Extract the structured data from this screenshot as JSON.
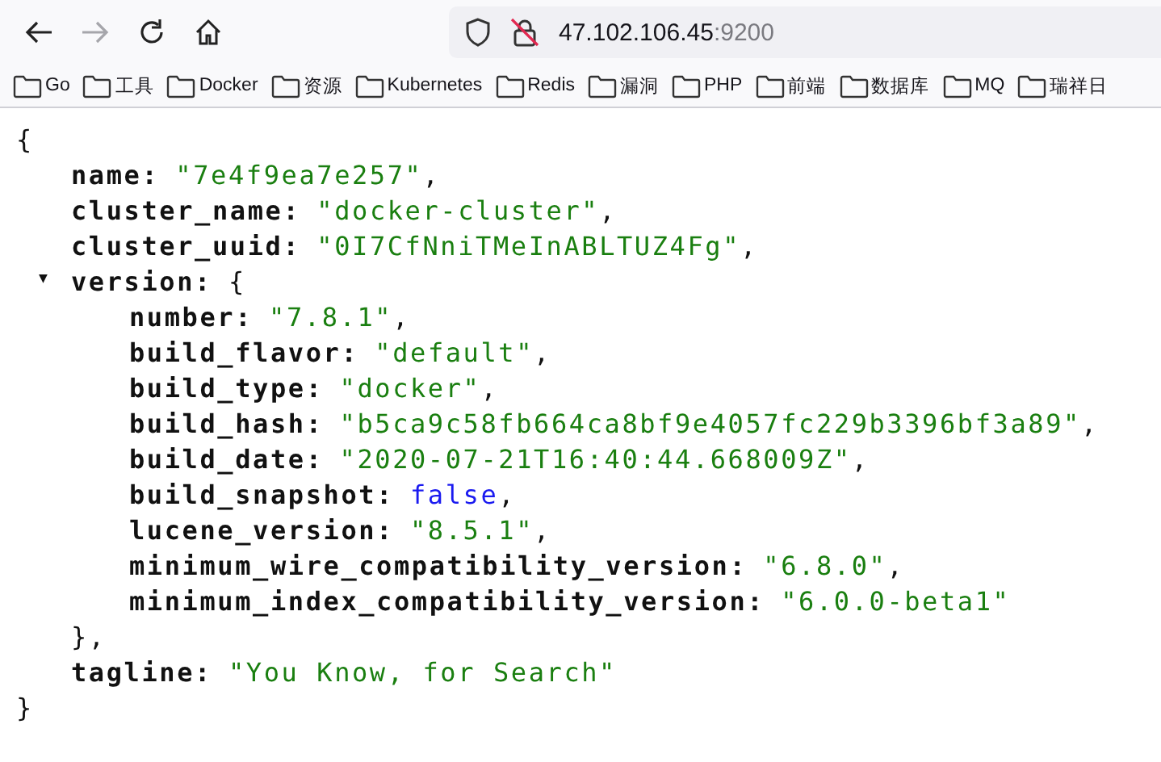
{
  "toolbar": {
    "back_disabled": false,
    "forward_disabled": true,
    "url": {
      "host": "47.102.106.45",
      "port": ":9200"
    }
  },
  "bookmarks": [
    {
      "label": "Go"
    },
    {
      "label": "工具"
    },
    {
      "label": "Docker"
    },
    {
      "label": "资源"
    },
    {
      "label": "Kubernetes"
    },
    {
      "label": "Redis"
    },
    {
      "label": "漏洞"
    },
    {
      "label": "PHP"
    },
    {
      "label": "前端"
    },
    {
      "label": "数据库"
    },
    {
      "label": "MQ"
    },
    {
      "label": "瑞祥日"
    }
  ],
  "json_view": {
    "open": "{",
    "close": "}",
    "entries": [
      {
        "kind": "string",
        "key": "name:",
        "value": "\"7e4f9ea7e257\"",
        "comma": ","
      },
      {
        "kind": "string",
        "key": "cluster_name:",
        "value": "\"docker-cluster\"",
        "comma": ","
      },
      {
        "kind": "string",
        "key": "cluster_uuid:",
        "value": "\"0I7CfNniTMeInABLTUZ4Fg\"",
        "comma": ","
      },
      {
        "kind": "object",
        "key": "version:",
        "toggle": "▼",
        "expanded": true,
        "open": "{",
        "close": "},",
        "children": [
          {
            "kind": "string",
            "key": "number:",
            "value": "\"7.8.1\"",
            "comma": ","
          },
          {
            "kind": "string",
            "key": "build_flavor:",
            "value": "\"default\"",
            "comma": ","
          },
          {
            "kind": "string",
            "key": "build_type:",
            "value": "\"docker\"",
            "comma": ","
          },
          {
            "kind": "string",
            "key": "build_hash:",
            "value": "\"b5ca9c58fb664ca8bf9e4057fc229b3396bf3a89\"",
            "comma": ","
          },
          {
            "kind": "string",
            "key": "build_date:",
            "value": "\"2020-07-21T16:40:44.668009Z\"",
            "comma": ","
          },
          {
            "kind": "boolean",
            "key": "build_snapshot:",
            "value": "false",
            "comma": ","
          },
          {
            "kind": "string",
            "key": "lucene_version:",
            "value": "\"8.5.1\"",
            "comma": ","
          },
          {
            "kind": "string",
            "key": "minimum_wire_compatibility_version:",
            "value": "\"6.8.0\"",
            "comma": ","
          },
          {
            "kind": "string",
            "key": "minimum_index_compatibility_version:",
            "value": "\"6.0.0-beta1\""
          }
        ]
      },
      {
        "kind": "string",
        "key": "tagline:",
        "value": "\"You Know, for Search\""
      }
    ]
  }
}
